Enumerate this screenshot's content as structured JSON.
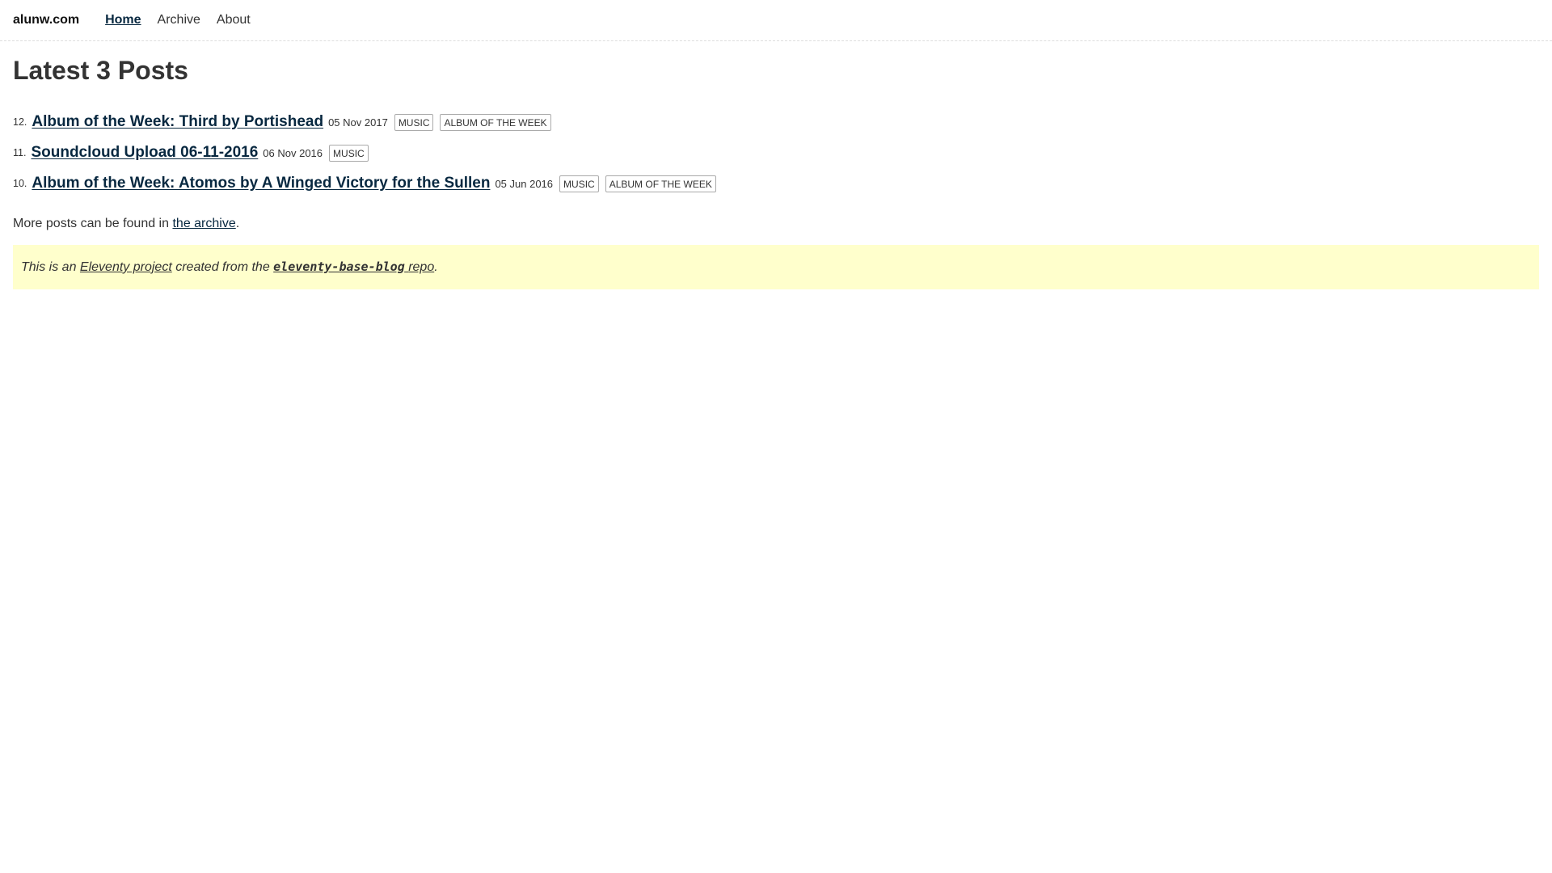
{
  "header": {
    "site_title": "alunw.com",
    "nav": [
      {
        "label": "Home",
        "active": true
      },
      {
        "label": "Archive",
        "active": false
      },
      {
        "label": "About",
        "active": false
      }
    ]
  },
  "main": {
    "heading": "Latest 3 Posts",
    "posts": [
      {
        "number": "12.",
        "title": "Album of the Week: Third by Portishead",
        "date": "05 Nov 2017",
        "tags": [
          "MUSIC",
          "ALBUM OF THE WEEK"
        ]
      },
      {
        "number": "11.",
        "title": "Soundcloud Upload 06-11-2016",
        "date": "06 Nov 2016",
        "tags": [
          "MUSIC"
        ]
      },
      {
        "number": "10.",
        "title": "Album of the Week: Atomos by A Winged Victory for the Sullen",
        "date": "05 Jun 2016",
        "tags": [
          "MUSIC",
          "ALBUM OF THE WEEK"
        ]
      }
    ],
    "more_text": "More posts can be found in",
    "more_link": "the archive",
    "more_period": "."
  },
  "message": {
    "prefix": "This is an",
    "project_link": "Eleventy project",
    "middle": "created from the",
    "repo_code": "eleventy-base-blog",
    "repo_suffix": "repo",
    "period": "."
  }
}
